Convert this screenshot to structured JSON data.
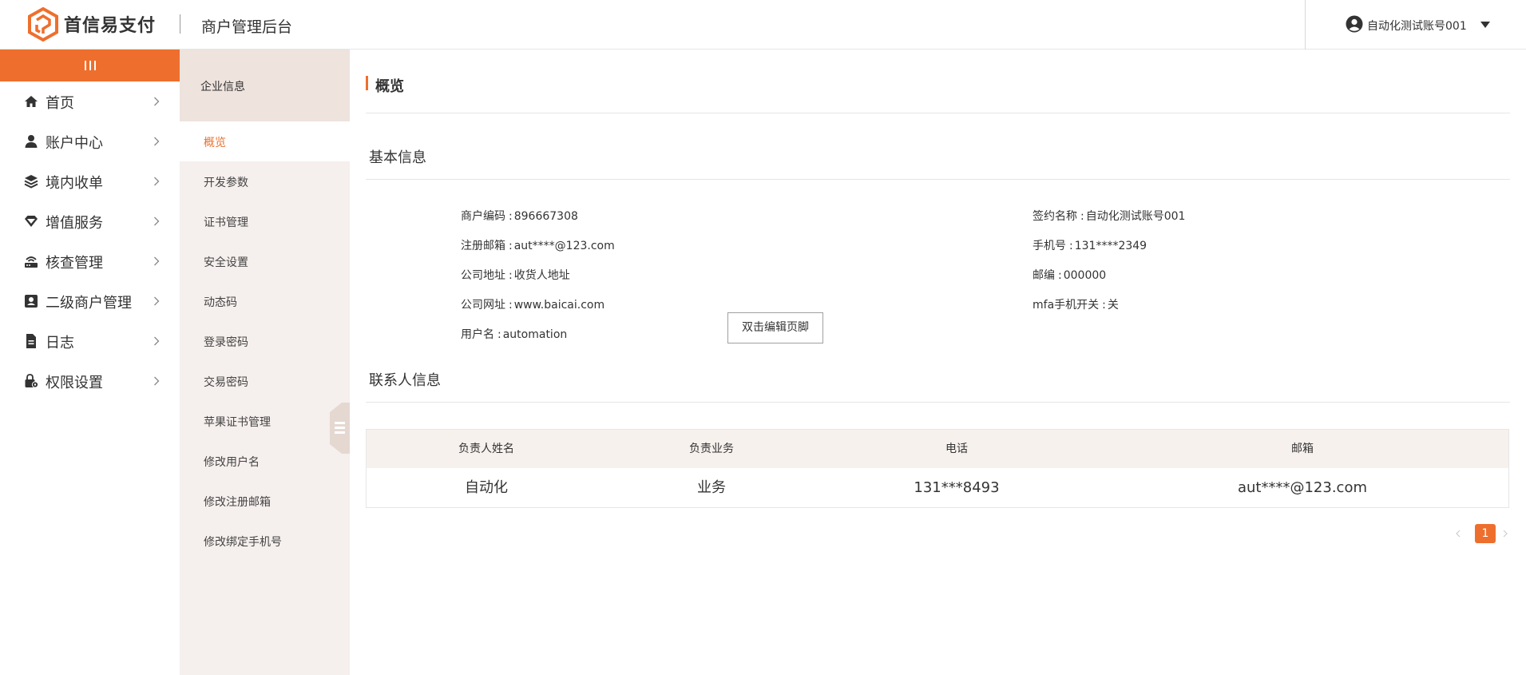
{
  "header": {
    "brand_name": "首信易支付",
    "title": "商户管理后台",
    "user_name": "自动化测试账号001"
  },
  "colors": {
    "accent": "#ee6f2d",
    "subnav_bg": "#f5efed",
    "subnav_head_bg": "#eee3dd",
    "table_head_bg": "#f7f1ee"
  },
  "left_nav": {
    "items": [
      {
        "label": "首页",
        "icon": "home-icon"
      },
      {
        "label": "账户中心",
        "icon": "user-icon"
      },
      {
        "label": "境内收单",
        "icon": "layers-icon"
      },
      {
        "label": "增值服务",
        "icon": "diamond-icon"
      },
      {
        "label": "核查管理",
        "icon": "router-icon"
      },
      {
        "label": "二级商户管理",
        "icon": "id-card-icon"
      },
      {
        "label": "日志",
        "icon": "document-icon"
      },
      {
        "label": "权限设置",
        "icon": "lock-gear-icon"
      }
    ]
  },
  "sub_nav": {
    "header": "企业信息",
    "items": [
      {
        "label": "概览",
        "active": true
      },
      {
        "label": "开发参数"
      },
      {
        "label": "证书管理"
      },
      {
        "label": "安全设置"
      },
      {
        "label": "动态码"
      },
      {
        "label": "登录密码"
      },
      {
        "label": "交易密码"
      },
      {
        "label": "苹果证书管理"
      },
      {
        "label": "修改用户名"
      },
      {
        "label": "修改注册邮箱"
      },
      {
        "label": "修改绑定手机号"
      }
    ]
  },
  "main": {
    "page_title": "概览",
    "basic_info": {
      "title": "基本信息",
      "left": [
        {
          "key": "商户编码",
          "value": "896667308"
        },
        {
          "key": "注册邮箱",
          "value": "aut****@123.com"
        },
        {
          "key": "公司地址",
          "value": "收货人地址"
        },
        {
          "key": "公司网址",
          "value": "www.baicai.com"
        },
        {
          "key": "用户名",
          "value": "automation"
        }
      ],
      "right": [
        {
          "key": "签约名称",
          "value": "自动化测试账号001"
        },
        {
          "key": "手机号",
          "value": "131****2349"
        },
        {
          "key": "邮编",
          "value": "000000"
        },
        {
          "key": "mfa手机开关",
          "value": "关"
        }
      ]
    },
    "footer_edit_button": "双击编辑页脚",
    "contact_info": {
      "title": "联系人信息",
      "columns": [
        "负责人姓名",
        "负责业务",
        "电话",
        "邮箱"
      ],
      "rows": [
        [
          "自动化",
          "业务",
          "131***8493",
          "aut****@123.com"
        ]
      ]
    },
    "pagination": {
      "current_page": "1"
    }
  }
}
